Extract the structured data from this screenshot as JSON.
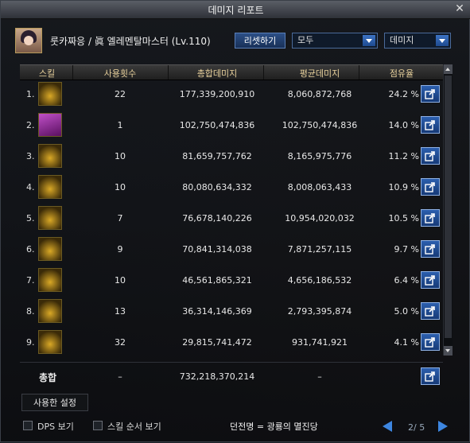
{
  "window": {
    "title": "데미지 리포트",
    "close_glyph": "✕"
  },
  "header": {
    "character": "룻카짜응 / 眞 엘레멘탈마스터 (Lv.110)",
    "reset_label": "리셋하기",
    "filter_select": "모두",
    "metric_select": "데미지"
  },
  "columns": {
    "skill": "스킬",
    "uses": "사용횟수",
    "total": "총합데미지",
    "avg": "평균데미지",
    "share": "점유율"
  },
  "rows": [
    {
      "rank": "1.",
      "uses": "22",
      "total": "177,339,200,910",
      "avg": "8,060,872,768",
      "share": "24.2 %",
      "icon": "flame-wave-icon"
    },
    {
      "rank": "2.",
      "uses": "1",
      "total": "102,750,474,836",
      "avg": "102,750,474,836",
      "share": "14.0 %",
      "icon": "magic-circle-icon"
    },
    {
      "rank": "3.",
      "uses": "10",
      "total": "81,659,757,762",
      "avg": "8,165,975,776",
      "share": "11.2 %",
      "icon": "meteor-icon"
    },
    {
      "rank": "4.",
      "uses": "10",
      "total": "80,080,634,332",
      "avg": "8,008,063,433",
      "share": "10.9 %",
      "icon": "crystal-burst-icon"
    },
    {
      "rank": "5.",
      "uses": "7",
      "total": "76,678,140,226",
      "avg": "10,954,020,032",
      "share": "10.5 %",
      "icon": "lightning-bolt-icon"
    },
    {
      "rank": "6.",
      "uses": "9",
      "total": "70,841,314,038",
      "avg": "7,871,257,115",
      "share": "9.7 %",
      "icon": "vortex-icon"
    },
    {
      "rank": "7.",
      "uses": "10",
      "total": "46,561,865,321",
      "avg": "4,656,186,532",
      "share": "6.4 %",
      "icon": "pillar-icon"
    },
    {
      "rank": "8.",
      "uses": "13",
      "total": "36,314,146,369",
      "avg": "2,793,395,874",
      "share": "5.0 %",
      "icon": "golden-bloom-icon"
    },
    {
      "rank": "9.",
      "uses": "32",
      "total": "29,815,741,472",
      "avg": "931,741,921",
      "share": "4.1 %",
      "icon": "fire-pillar-icon"
    }
  ],
  "total_row": {
    "label": "총합",
    "uses": "–",
    "total": "732,218,370,214",
    "avg": "–"
  },
  "tab_label": "사용한 설정",
  "bottom": {
    "dps_label": "DPS 보기",
    "order_label": "스킬 순서 보기",
    "dungeon": "던전명 = 광룡의 멸진당",
    "page": "2/ 5"
  },
  "colors": {
    "accent": "#2c5fae",
    "header_text": "#e8d19c",
    "icon_gold": "#d9a826"
  }
}
